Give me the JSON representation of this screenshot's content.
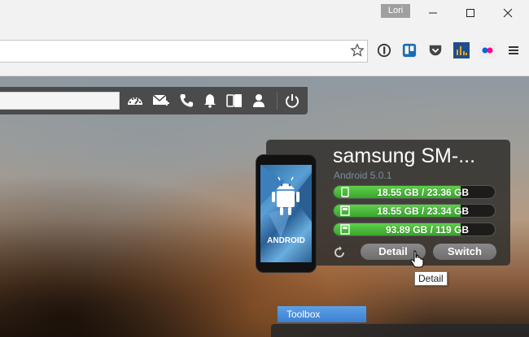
{
  "window": {
    "user": "Lori"
  },
  "device": {
    "name": "samsung SM-...",
    "os": "Android 5.0.1",
    "phone_label": "ANDROID",
    "storage": [
      {
        "text": "18.55 GB / 23.36 GB",
        "fraction": 0.79,
        "icon": "phone-storage-icon"
      },
      {
        "text": "18.55 GB / 23.34 GB",
        "fraction": 0.79,
        "icon": "sd-card-icon"
      },
      {
        "text": "93.89 GB / 119 GB",
        "fraction": 0.79,
        "icon": "sd-card-icon"
      }
    ],
    "detail_label": "Detail",
    "switch_label": "Switch"
  },
  "tooltip": "Detail",
  "toolbox": {
    "label": "Toolbox"
  },
  "colors": {
    "storage_green": "#3aa52e",
    "toolbox_blue": "#3a80d2",
    "card_bg": "#302e2c"
  },
  "icons": {
    "nav": [
      "dashboard-icon",
      "mail-icon",
      "phone-icon",
      "bell-icon",
      "mirror-icon",
      "user-icon",
      "power-icon"
    ],
    "extensions": [
      "1password-icon",
      "trello-icon",
      "pocket-icon",
      "analytics-icon",
      "flickr-icon",
      "menu-icon"
    ]
  }
}
